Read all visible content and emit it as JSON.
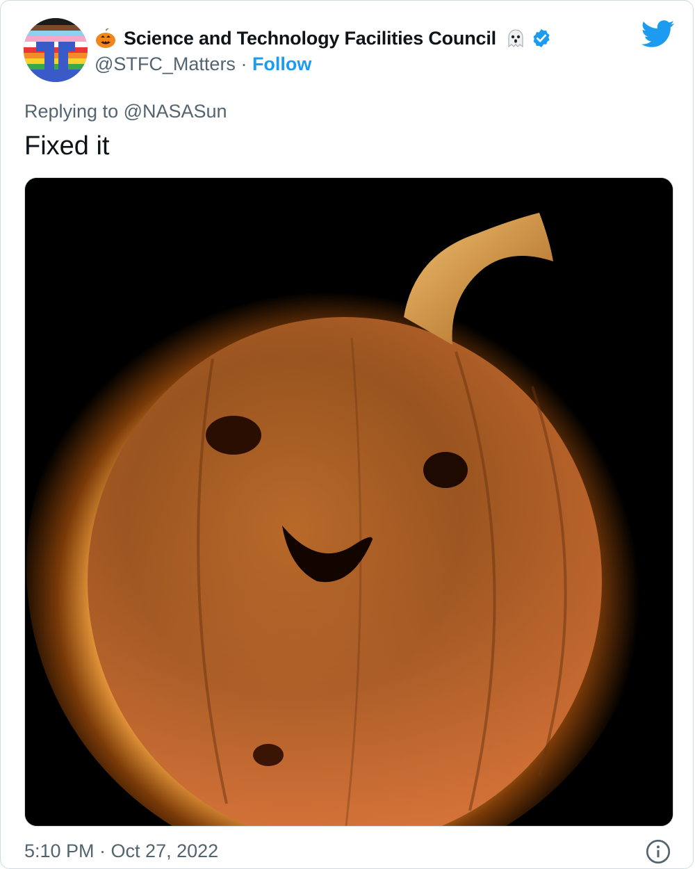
{
  "tweet": {
    "display_name": "Science and Technology Facilities Council",
    "handle": "@STFC_Matters",
    "separator": " · ",
    "follow_label": "Follow",
    "reply_prefix": "Replying to ",
    "reply_to": "@NASASun",
    "text": "Fixed it",
    "timestamp": "5:10 PM · Oct 27, 2022"
  },
  "icons": {
    "name_prefix_emoji": "pumpkin-emoji",
    "name_suffix_emoji": "ghost-emoji",
    "verified_badge": "verified-badge-icon",
    "platform_logo": "twitter-bird-icon",
    "info": "info-icon"
  },
  "media": {
    "description_icon": "sun-pumpkin-image"
  },
  "colors": {
    "link": "#1d9bf0",
    "secondary_text": "#536471",
    "primary_text": "#0f1419",
    "border": "#cfd9de"
  }
}
